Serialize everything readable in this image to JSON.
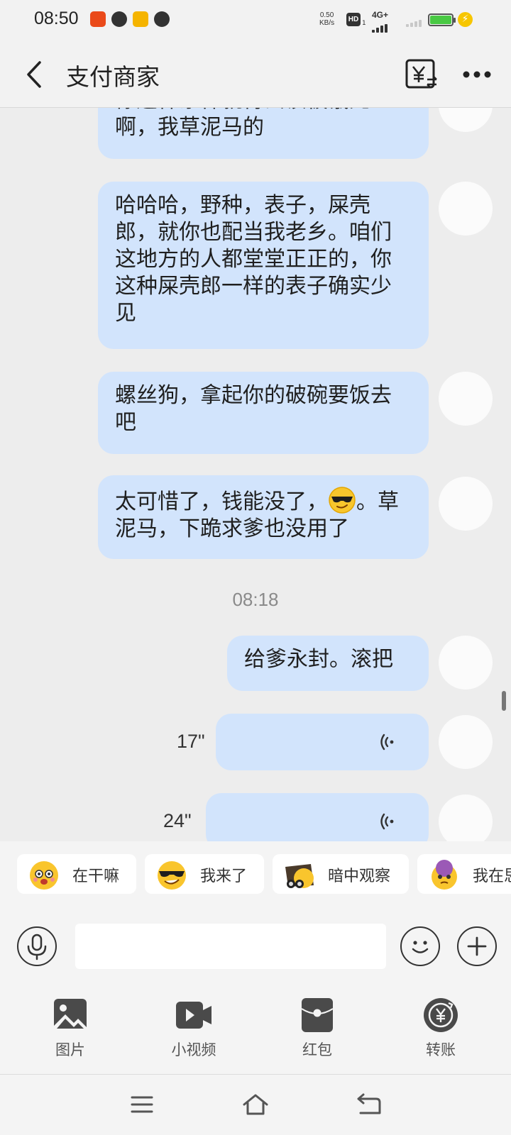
{
  "status_bar": {
    "time": "08:50",
    "speed_value": "0.50",
    "speed_unit": "KB/s",
    "hd": "HD",
    "hd_sub": "1",
    "network": "4G+",
    "battery_color": "#49c944"
  },
  "header": {
    "title": "支付商家"
  },
  "messages": [
    {
      "text": "你这样东样就得去该被饿死啊，我草泥马的"
    },
    {
      "text": "哈哈哈，野种，表子，屎壳郎，就你也配当我老乡。咱们这地方的人都堂堂正正的，你这种屎壳郎一样的表子确实少见"
    },
    {
      "text": "螺丝狗，拿起你的破碗要饭去吧"
    },
    {
      "text_before": "太可惜了，钱能没了，",
      "emoji": "cool-face-emoji",
      "text_after": "。草泥马，下跪求爹也没用了"
    },
    {
      "timestamp": "08:18"
    },
    {
      "text": "给爹永封。滚把"
    },
    {
      "voice_duration": "17\""
    },
    {
      "voice_duration": "24\""
    }
  ],
  "stickers": [
    {
      "label": "在干嘛",
      "icon": "sticker-doing-what"
    },
    {
      "label": "我来了",
      "icon": "sticker-coming"
    },
    {
      "label": "暗中观察",
      "icon": "sticker-observing"
    },
    {
      "label": "我在思考",
      "icon": "sticker-thinking"
    }
  ],
  "input": {
    "placeholder": "",
    "value": ""
  },
  "tools": [
    {
      "label": "图片",
      "icon": "image-icon"
    },
    {
      "label": "小视频",
      "icon": "video-icon"
    },
    {
      "label": "红包",
      "icon": "red-packet-icon"
    },
    {
      "label": "转账",
      "icon": "transfer-icon"
    }
  ],
  "colors": {
    "bubble": "#d2e4fc",
    "background": "#ededed"
  }
}
